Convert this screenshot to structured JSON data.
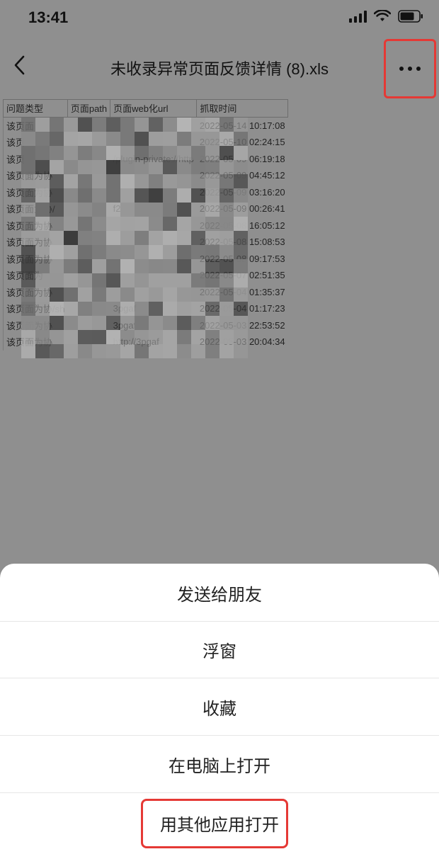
{
  "status_bar": {
    "time": "13:41"
  },
  "nav": {
    "title": "未收录异常页面反馈详情 (8).xls",
    "back_icon": "chevron-left-icon",
    "more_icon": "more-dots-icon"
  },
  "sheet": {
    "headers": [
      "问题类型",
      "页面path",
      "页面web化url",
      "抓取时间"
    ],
    "rows": [
      [
        "该页面",
        "",
        "",
        "2022-05-14 10:17:08"
      ],
      [
        "该页",
        "",
        "",
        "2022-05-10 02:24:15"
      ],
      [
        "该页",
        "",
        "/plugin-private://http",
        "2022-05-09 06:19:18"
      ],
      [
        "该页面为协",
        "",
        "",
        "2022-05-09 04:45:12"
      ],
      [
        "该页面为协",
        "",
        "",
        "2022-05-09 03:16:20"
      ],
      [
        "该页面为协/",
        "",
        "f2",
        "2022-05-09 00:26:41"
      ],
      [
        "该页面为协",
        "",
        "",
        "2022-05-08 16:05:12"
      ],
      [
        "该页面为协",
        "",
        "",
        "2022-05-08 15:08:53"
      ],
      [
        "该页面为协",
        "",
        "",
        "2022-05-08 09:17:53"
      ],
      [
        "该页面为",
        "",
        "",
        "2022-05-07 02:51:35"
      ],
      [
        "该页面为协",
        "",
        "",
        "2022-05-04 01:35:37"
      ],
      [
        "该页面为协/sh",
        "",
        "3pgaf",
        "2022-05-04 01:17:23"
      ],
      [
        "该页面为协",
        "",
        "3pgaf",
        "2022-05-03 22:53:52"
      ],
      [
        "该页面为协",
        "",
        "http://3pgaf",
        "2022-05-03 20:04:34"
      ]
    ]
  },
  "action_sheet": {
    "send_to_friend": "发送给朋友",
    "floating_window": "浮窗",
    "favorite": "收藏",
    "open_on_computer": "在电脑上打开",
    "open_with_other_app": "用其他应用打开"
  },
  "colors": {
    "dim_overlay": "#8f8f8f",
    "highlight_red": "#e53935",
    "sheet_bg": "#ffffff"
  }
}
